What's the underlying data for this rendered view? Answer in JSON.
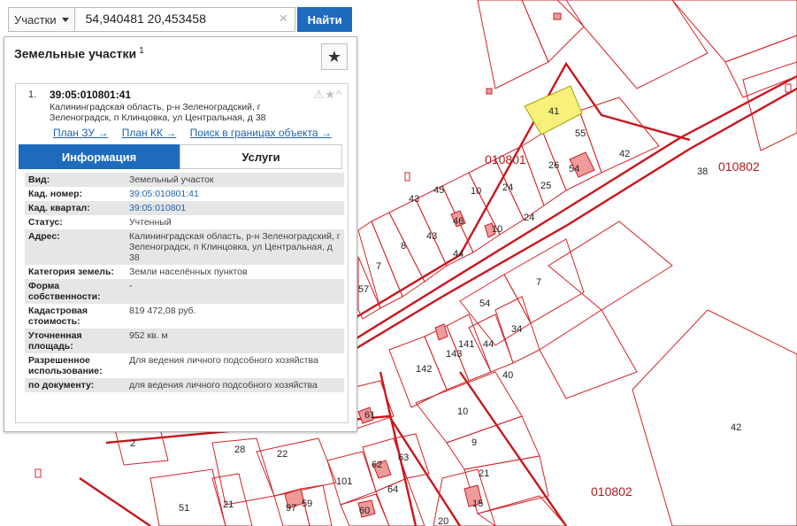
{
  "search": {
    "type_label": "Участки",
    "query": "54,940481 20,453458",
    "submit_label": "Найти"
  },
  "panel": {
    "title": "Земельные участки",
    "count": "1"
  },
  "result": {
    "index": "1.",
    "cad_number": "39:05:010801:41",
    "address": "Калининградская область, р-н Зеленоградский, г Зеленоградск, п Клинцовка, ул Центральная, д 38",
    "links": [
      "План ЗУ →",
      "План КК →",
      "Поиск в границах объекта →"
    ],
    "tabs": [
      "Информация",
      "Услуги"
    ]
  },
  "info": [
    {
      "key": "Вид:",
      "value": "Земельный участок"
    },
    {
      "key": "Кад. номер:",
      "value": "39:05:010801:41",
      "link": true
    },
    {
      "key": "Кад. квартал:",
      "value": "39:05:010801",
      "link": true
    },
    {
      "key": "Статус:",
      "value": "Учтенный"
    },
    {
      "key": "Адрес:",
      "value": "Калининградская область, р-н Зеленоградский, г Зеленоградск, п Клинцовка, ул Центральная, д 38"
    },
    {
      "key": "Категория земель:",
      "value": "Земли населённых пунктов"
    },
    {
      "key": "Форма собственности:",
      "value": "-"
    },
    {
      "key": "Кадастровая стоимость:",
      "value": "819 472,08 руб."
    },
    {
      "key": "Уточненная площадь:",
      "value": "952 кв. м"
    },
    {
      "key": "Разрешенное использование:",
      "value": "Для ведения личного подсобного хозяйства"
    },
    {
      "key": "по документу:",
      "value": "для ведения личного подсобного хозяйства"
    }
  ],
  "map": {
    "quarters": [
      "010801",
      "010802",
      "010802"
    ],
    "parcel_labels": [
      "41",
      "55",
      "42",
      "38",
      "54",
      "26",
      "25",
      "24",
      "10",
      "45",
      "43",
      "46",
      "8",
      "7",
      "57",
      "10",
      "44",
      "43",
      "24",
      "54",
      "7",
      "34",
      "141",
      "143",
      "44",
      "40",
      "142",
      "10",
      "9",
      "21",
      "20",
      "15",
      "61",
      "62",
      "63",
      "64",
      "101",
      "28",
      "22",
      "51",
      "21",
      "2",
      "97",
      "59",
      "60",
      "42"
    ],
    "highlight_color": "#f7f07a"
  }
}
